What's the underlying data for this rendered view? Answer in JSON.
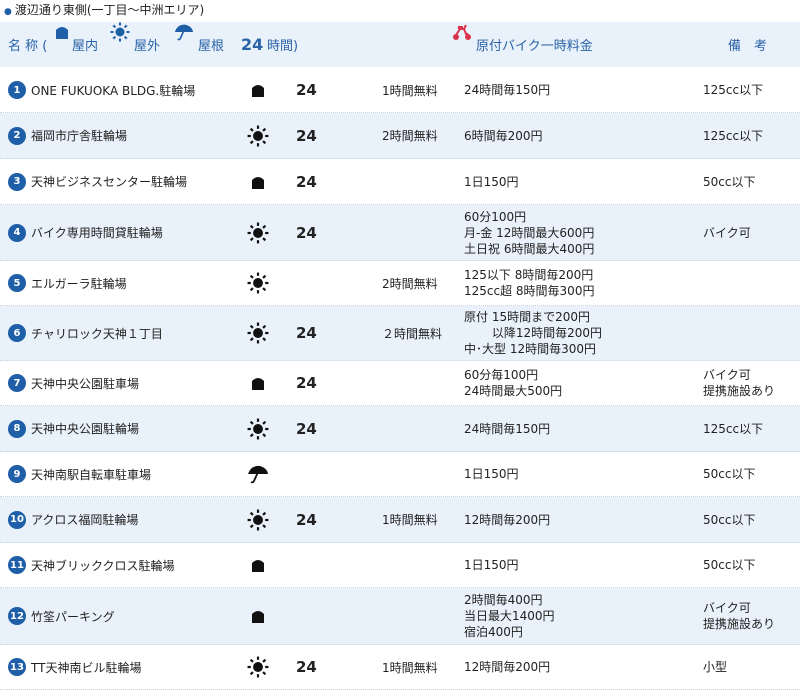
{
  "page": {
    "title": "渡辺通り東側(一丁目～中洲エリア)",
    "accent_color": "#1f5fa8",
    "header_bg": "#e9f1fa"
  },
  "header": {
    "name_label": "名 称 (",
    "indoor_label": "屋内",
    "outdoor_label": "屋外",
    "roof_label": "屋根",
    "hours_24": "24",
    "hours_label": "時間)",
    "fee_label": "原付バイク一時料金",
    "note_label": "備　考",
    "fee_icon": "scooter-icon"
  },
  "rows": [
    {
      "num": "1",
      "name": "ONE FUKUOKA BLDG.駐輪場",
      "type": "indoor",
      "h24": "24",
      "free": "1時間無料",
      "fee": [
        "24時間毎150円"
      ],
      "note": [
        "125cc以下"
      ]
    },
    {
      "num": "2",
      "name": "福岡市庁舎駐輪場",
      "type": "outdoor",
      "h24": "24",
      "free": "2時間無料",
      "fee": [
        "6時間毎200円"
      ],
      "note": [
        "125cc以下"
      ]
    },
    {
      "num": "3",
      "name": "天神ビジネスセンター駐輪場",
      "type": "indoor",
      "h24": "24",
      "free": "",
      "fee": [
        "1日150円"
      ],
      "note": [
        "50cc以下"
      ]
    },
    {
      "num": "4",
      "name": "バイク専用時間貸駐輪場",
      "type": "outdoor",
      "h24": "24",
      "free": "",
      "fee": [
        "60分100円",
        "月-金 12時間最大600円",
        "土日祝 6時間最大400円"
      ],
      "note": [
        "バイク可"
      ]
    },
    {
      "num": "5",
      "name": "エルガーラ駐輪場",
      "type": "outdoor",
      "h24": "",
      "free": "2時間無料",
      "fee": [
        "125以下 8時間毎200円",
        "125cc超 8時間毎300円"
      ],
      "note": []
    },
    {
      "num": "6",
      "name": "チャリロック天神１丁目",
      "type": "outdoor",
      "h24": "24",
      "free": "２時間無料",
      "fee": [
        "原付 15時間まで200円",
        "　　 以降12時間毎200円",
        "中･大型 12時間毎300円"
      ],
      "note": []
    },
    {
      "num": "7",
      "name": "天神中央公園駐車場",
      "type": "indoor",
      "h24": "24",
      "free": "",
      "fee": [
        "60分毎100円",
        "24時間最大500円"
      ],
      "note": [
        "バイク可",
        "提携施設あり"
      ]
    },
    {
      "num": "8",
      "name": "天神中央公園駐輪場",
      "type": "outdoor",
      "h24": "24",
      "free": "",
      "fee": [
        "24時間毎150円"
      ],
      "note": [
        "125cc以下"
      ]
    },
    {
      "num": "9",
      "name": "天神南駅自転車駐車場",
      "type": "roof",
      "h24": "",
      "free": "",
      "fee": [
        "1日150円"
      ],
      "note": [
        "50cc以下"
      ]
    },
    {
      "num": "10",
      "name": "アクロス福岡駐輪場",
      "type": "outdoor",
      "h24": "24",
      "free": "1時間無料",
      "fee": [
        "12時間毎200円"
      ],
      "note": [
        "50cc以下"
      ]
    },
    {
      "num": "11",
      "name": "天神ブリッククロス駐輪場",
      "type": "indoor",
      "h24": "",
      "free": "",
      "fee": [
        "1日150円"
      ],
      "note": [
        "50cc以下"
      ]
    },
    {
      "num": "12",
      "name": "竹筌パーキング",
      "type": "indoor",
      "h24": "",
      "free": "",
      "fee": [
        "2時間毎400円",
        "当日最大1400円",
        "宿泊400円"
      ],
      "note": [
        "バイク可",
        "提携施設あり"
      ]
    },
    {
      "num": "13",
      "name": "TT天神南ビル駐輪場",
      "type": "outdoor",
      "h24": "24",
      "free": "1時間無料",
      "fee": [
        "12時間毎200円"
      ],
      "note": [
        "小型"
      ]
    }
  ]
}
